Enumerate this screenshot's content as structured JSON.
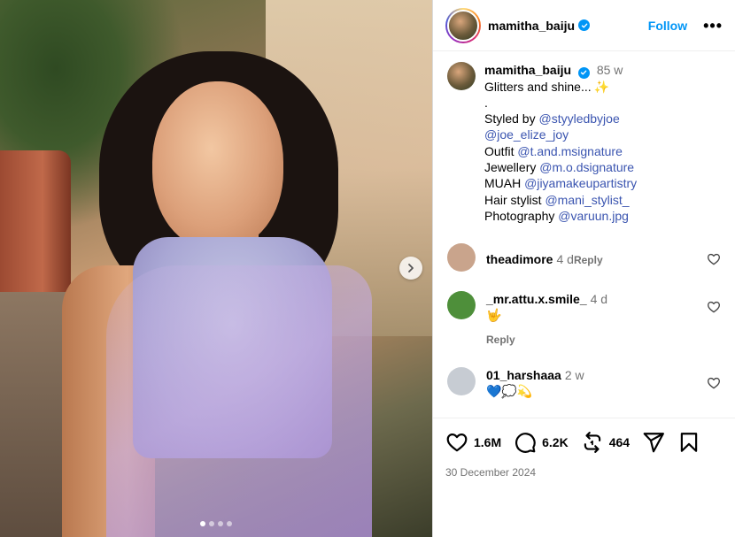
{
  "post": {
    "username": "mamitha_baiju",
    "follow_label": "Follow",
    "more_label": "•••"
  },
  "caption": {
    "username": "mamitha_baiju",
    "time": "85 w",
    "lines": [
      {
        "prefix": "Glitters and shine...",
        "mention": "",
        "emoji": "✨"
      },
      {
        "prefix": ".",
        "mention": "",
        "emoji": ""
      },
      {
        "prefix": "Styled by ",
        "mention": "@styyledbyjoe",
        "emoji": ""
      },
      {
        "prefix": "",
        "mention": "@joe_elize_joy",
        "emoji": ""
      },
      {
        "prefix": "Outfit ",
        "mention": "@t.and.msignature",
        "emoji": ""
      },
      {
        "prefix": "Jewellery ",
        "mention": "@m.o.dsignature",
        "emoji": ""
      },
      {
        "prefix": "MUAH ",
        "mention": "@jiyamakeupartistry",
        "emoji": ""
      },
      {
        "prefix": "Hair stylist ",
        "mention": "@mani_stylist_",
        "emoji": ""
      },
      {
        "prefix": "Photography ",
        "mention": "@varuun.jpg",
        "emoji": ""
      }
    ]
  },
  "comments": [
    {
      "username": "theadimore",
      "time": "4 d",
      "text": "",
      "reply_label": "Reply",
      "avatar_color": "#c9a48c"
    },
    {
      "username": "_mr.attu.x.smile_",
      "time": "4 d",
      "text": "🤟",
      "reply_label": "Reply",
      "avatar_color": "#4e8f3a"
    },
    {
      "username": "01_harshaaa",
      "time": "2 w",
      "text": "💙💭💫",
      "reply_label": "",
      "avatar_color": "#c7ccd3"
    }
  ],
  "stats": {
    "likes": "1.6M",
    "comments": "6.2K",
    "reposts": "464",
    "date": "30 December 2024"
  },
  "carousel": {
    "slide_count": 4,
    "active_slide": 1
  },
  "colors": {
    "accent": "#0095f6",
    "mention": "#3b55b0",
    "muted": "#737373"
  }
}
